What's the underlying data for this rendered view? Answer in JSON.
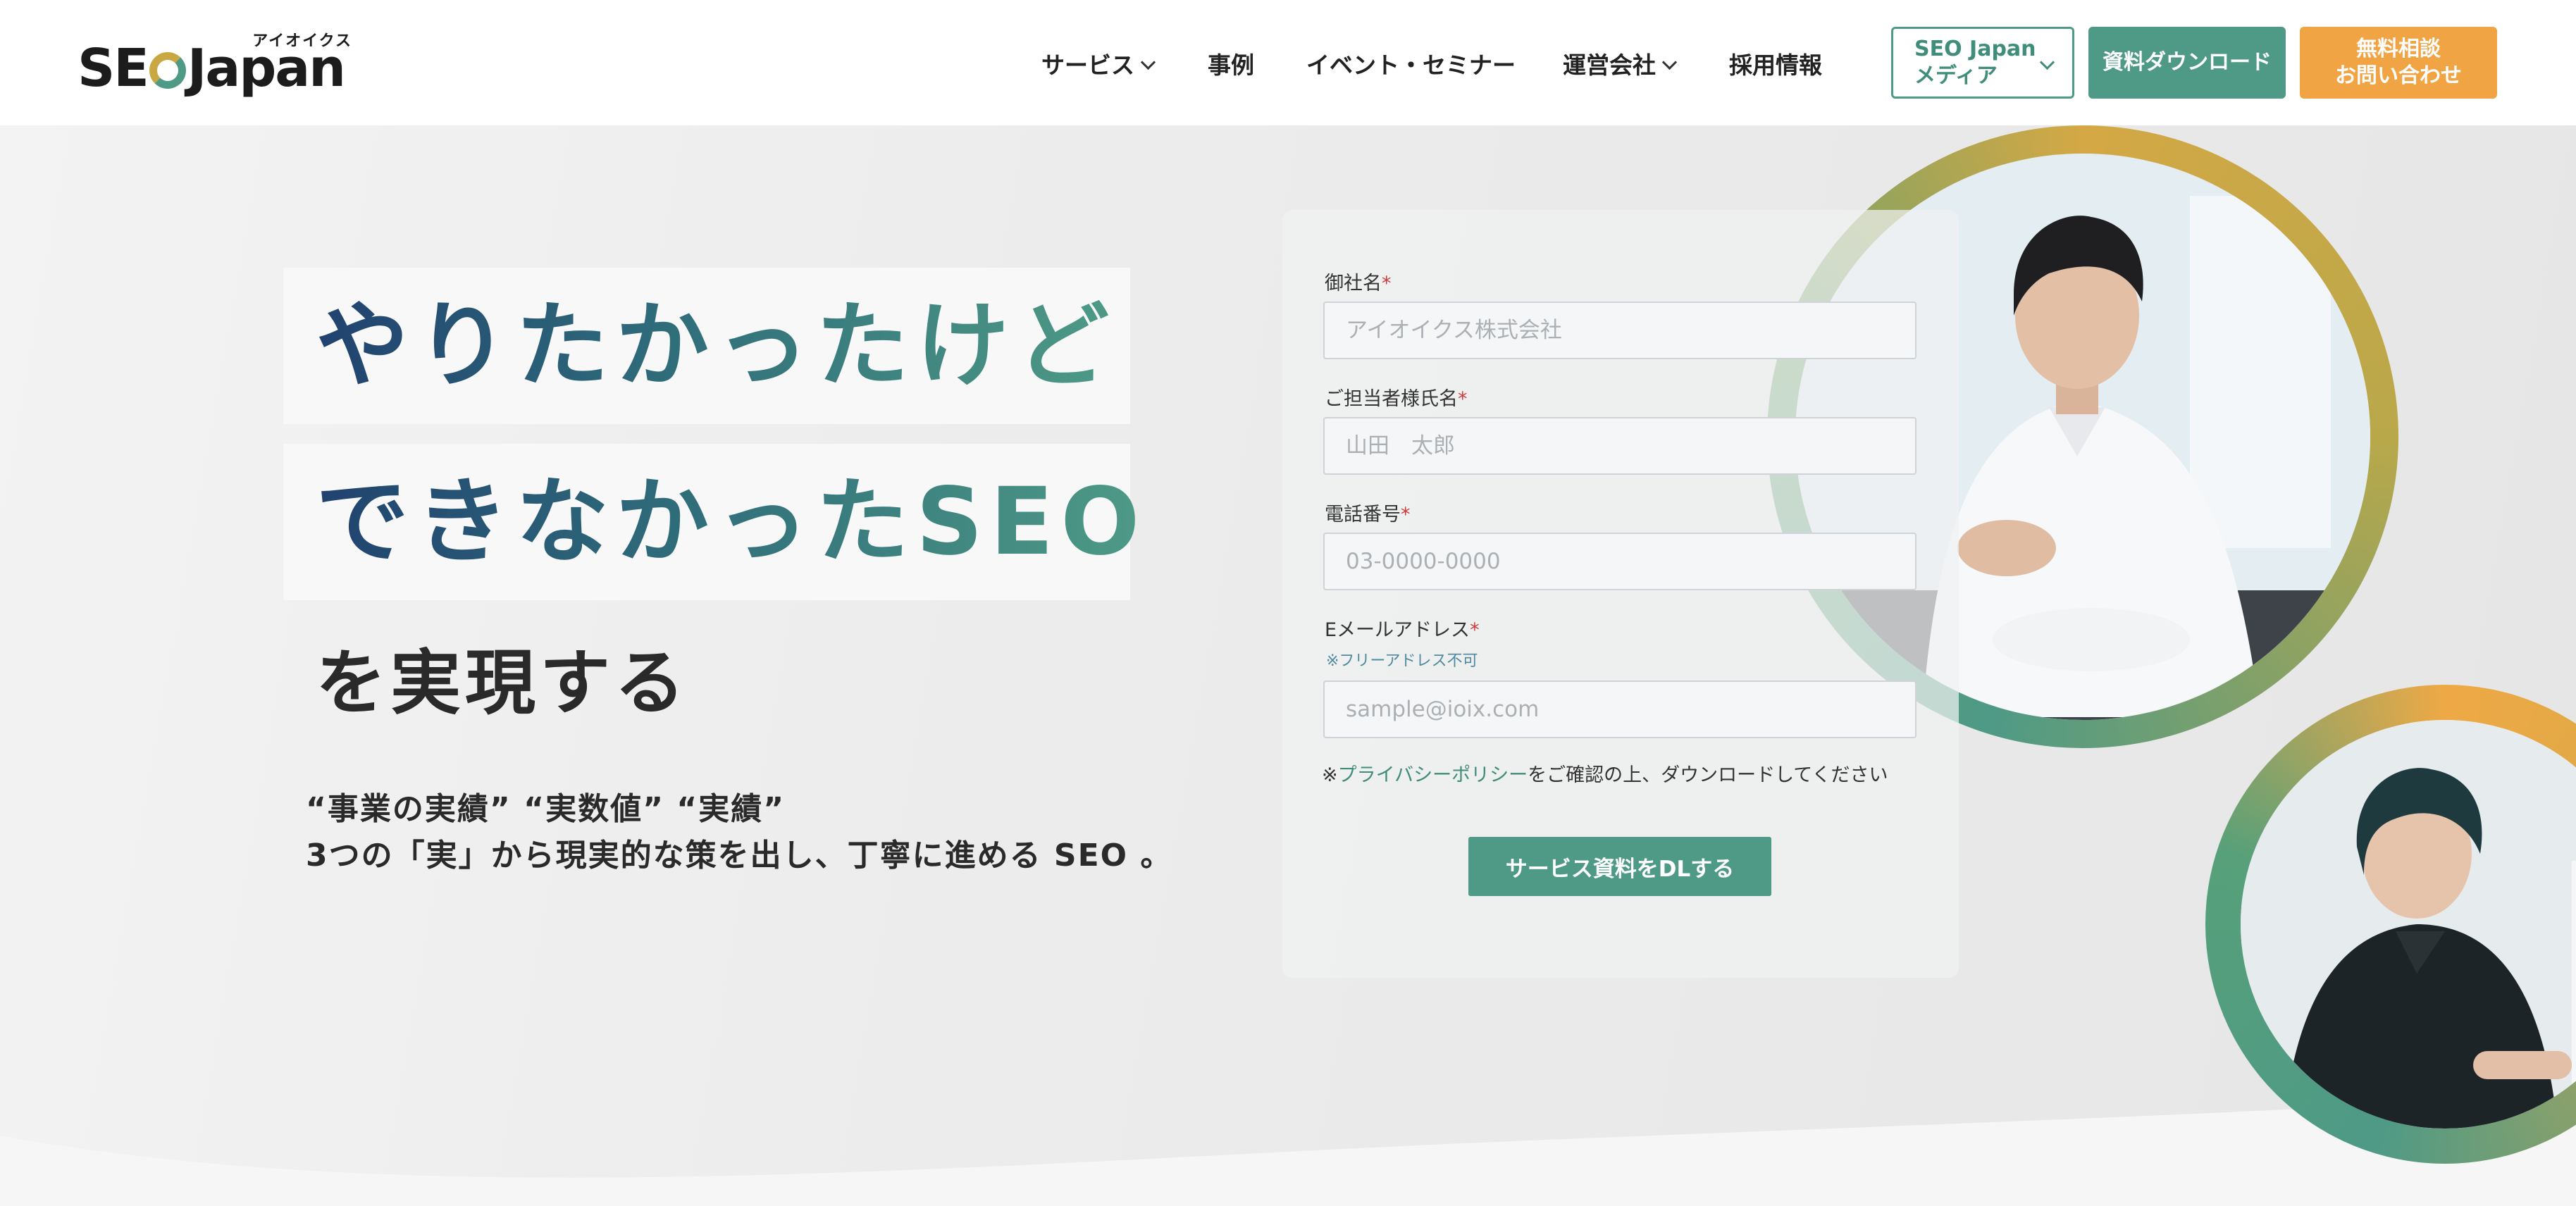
{
  "header": {
    "logo": {
      "main_prefix": "SE",
      "main_suffix": "Japan",
      "sub": "アイオイクス"
    },
    "nav": [
      {
        "label": "サービス",
        "has_dropdown": true
      },
      {
        "label": "事例",
        "has_dropdown": false
      },
      {
        "label": "イベント・セミナー",
        "has_dropdown": false
      },
      {
        "label": "運営会社",
        "has_dropdown": true
      },
      {
        "label": "採用情報",
        "has_dropdown": false
      }
    ],
    "media_button": "SEO Japan\nメディア",
    "download_button": "資料ダウンロード",
    "contact_button": "無料相談\nお問い合わせ"
  },
  "hero": {
    "headline_line1": "やりたかったけど",
    "headline_line2": "できなかったSEO",
    "headline_line3": "を実現する",
    "lead_line1": "“事業の実績” “実数値” “実績”",
    "lead_line2": "3つの「実」から現実的な策を出し、丁寧に進める SEO 。"
  },
  "form": {
    "company": {
      "label": "御社名",
      "required_mark": "*",
      "placeholder": "アイオイクス株式会社"
    },
    "person": {
      "label": "ご担当者様氏名",
      "required_mark": "*",
      "placeholder": "山田　太郎"
    },
    "phone": {
      "label": "電話番号",
      "required_mark": "*",
      "placeholder": "03-0000-0000"
    },
    "email": {
      "label": "Eメールアドレス",
      "required_mark": "*",
      "note": "※フリーアドレス不可",
      "placeholder": "sample@ioix.com"
    },
    "privacy_prefix": "※",
    "privacy_link": "プライバシーポリシー",
    "privacy_suffix": "をご確認の上、ダウンロードしてください",
    "submit": "サービス資料をDLする"
  },
  "colors": {
    "brand_green": "#4e9a86",
    "brand_orange": "#f0a443",
    "headline_navy": "#1f3e6e"
  }
}
